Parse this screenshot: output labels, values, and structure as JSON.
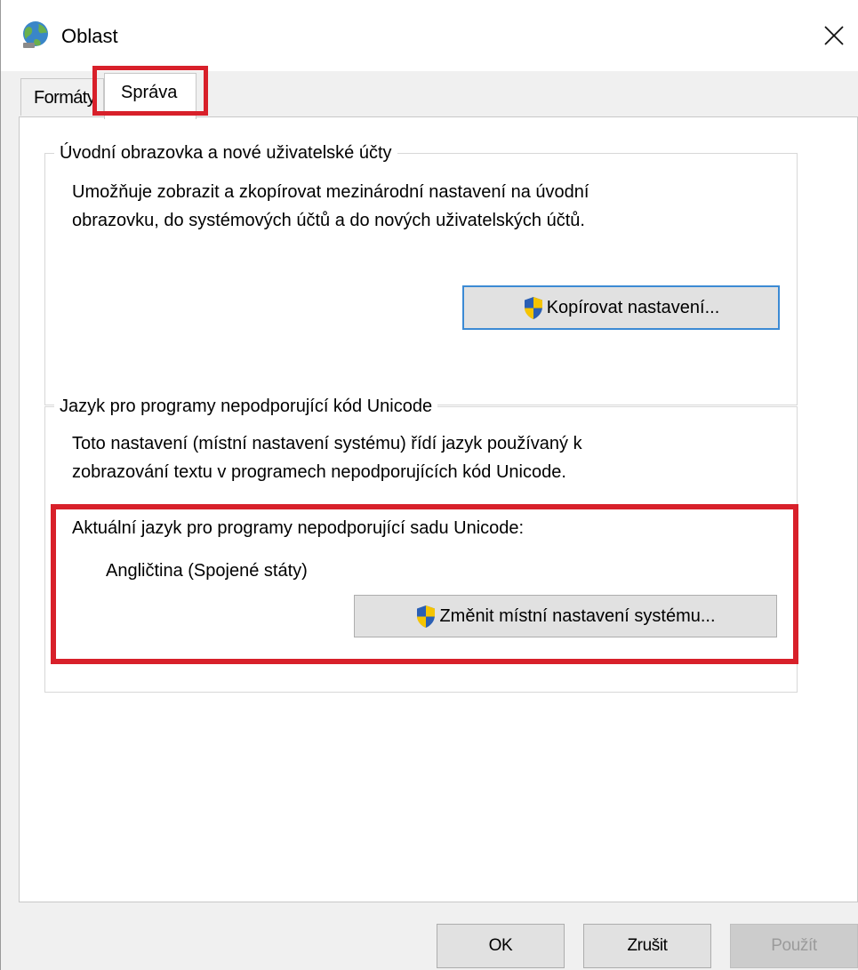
{
  "window": {
    "title": "Oblast",
    "icon": "globe-icon",
    "close_icon": "close-icon"
  },
  "tabs": [
    {
      "label": "Formáty",
      "selected": false
    },
    {
      "label": "Správa",
      "selected": true
    }
  ],
  "welcome_group": {
    "legend": "Úvodní obrazovka a nové uživatelské účty",
    "description_lines": [
      "Umožňuje zobrazit a zkopírovat mezinárodní nastavení na úvodní",
      "obrazovku, do systémových účtů a do nových uživatelských účtů."
    ],
    "button_label": "Kopírovat nastavení..."
  },
  "unicode_group": {
    "legend": "Jazyk pro programy nepodporující kód Unicode",
    "description_lines": [
      "Toto nastavení (místní nastavení systému) řídí jazyk používaný k",
      "zobrazování textu v programech nepodporujících kód Unicode."
    ],
    "current_label": "Aktuální jazyk pro programy nepodporující sadu Unicode:",
    "current_value": "Angličtina (Spojené státy)",
    "button_label": "Změnit místní nastavení systému..."
  },
  "footer": {
    "ok_label": "OK",
    "cancel_label": "Zrušit",
    "apply_label": "Použít",
    "apply_enabled": false
  },
  "colors": {
    "highlight_red": "#d8202a",
    "focus_blue": "#3c8ad4",
    "shield_blue": "#2a5fb4",
    "shield_yellow": "#f5c400"
  }
}
